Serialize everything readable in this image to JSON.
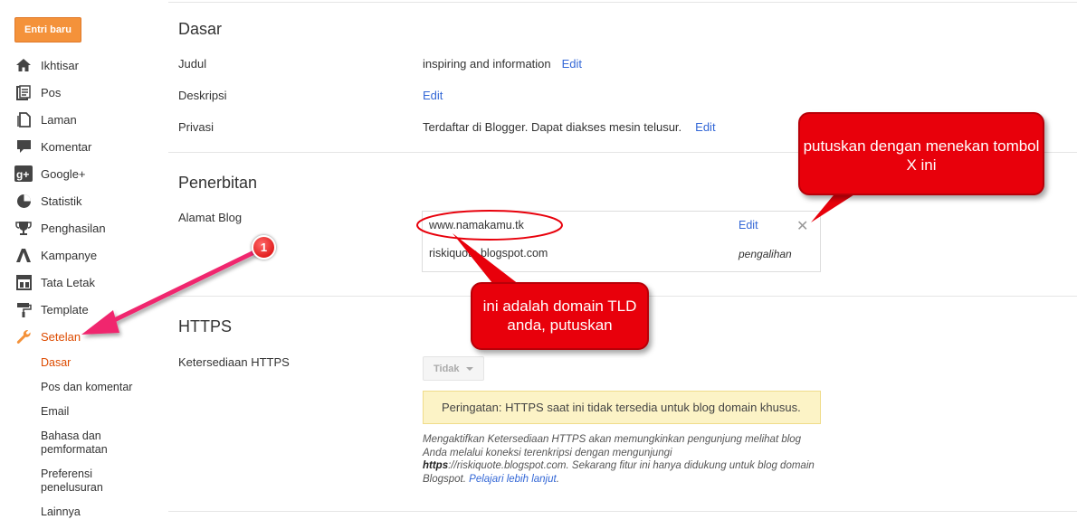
{
  "sidebar": {
    "new_post": "Entri baru",
    "items": [
      {
        "label": "Ikhtisar",
        "icon": "home-icon"
      },
      {
        "label": "Pos",
        "icon": "posts-icon"
      },
      {
        "label": "Laman",
        "icon": "pages-icon"
      },
      {
        "label": "Komentar",
        "icon": "comment-icon"
      },
      {
        "label": "Google+",
        "icon": "google-plus-icon"
      },
      {
        "label": "Statistik",
        "icon": "pie-chart-icon"
      },
      {
        "label": "Penghasilan",
        "icon": "trophy-icon"
      },
      {
        "label": "Kampanye",
        "icon": "campaign-icon"
      },
      {
        "label": "Tata Letak",
        "icon": "layout-icon"
      },
      {
        "label": "Template",
        "icon": "paint-roller-icon"
      },
      {
        "label": "Setelan",
        "icon": "wrench-icon"
      }
    ],
    "sub_items": [
      "Dasar",
      "Pos dan komentar",
      "Email",
      "Bahasa dan pemformatan",
      "Preferensi penelusuran",
      "Lainnya"
    ]
  },
  "basic": {
    "title": "Dasar",
    "title_label": "Judul",
    "title_value": "inspiring and information",
    "desc_label": "Deskripsi",
    "privacy_label": "Privasi",
    "privacy_value": "Terdaftar di Blogger. Dapat diakses mesin telusur.",
    "edit": "Edit"
  },
  "publishing": {
    "title": "Penerbitan",
    "address_label": "Alamat Blog",
    "custom_domain": "www.namakamu.tk",
    "blogspot_domain": "riskiquote.blogspot.com",
    "edit": "Edit",
    "redirect": "pengalihan"
  },
  "https": {
    "title": "HTTPS",
    "availability_label": "Ketersediaan HTTPS",
    "select_value": "Tidak",
    "warning": "Peringatan: HTTPS saat ini tidak tersedia untuk blog domain khusus.",
    "desc_1": "Mengaktifkan Ketersediaan HTTPS akan memungkinkan pengunjung melihat blog Anda melalui koneksi terenkripsi dengan mengunjungi ",
    "desc_bold": "https",
    "desc_2": "://riskiquote.blogspot.com. Sekarang fitur ini hanya didukung untuk blog domain Blogspot. ",
    "learn_more": "Pelajari lebih lanjut",
    "desc_end": "."
  },
  "annotations": {
    "callout_x": "putuskan dengan menekan tombol X ini",
    "callout_domain": "ini adalah domain TLD anda, putuskan",
    "marker": "1"
  },
  "colors": {
    "accent": "#dd4b00",
    "link": "#3367d6",
    "callout": "#e8000b",
    "arrow": "#f0286e"
  }
}
